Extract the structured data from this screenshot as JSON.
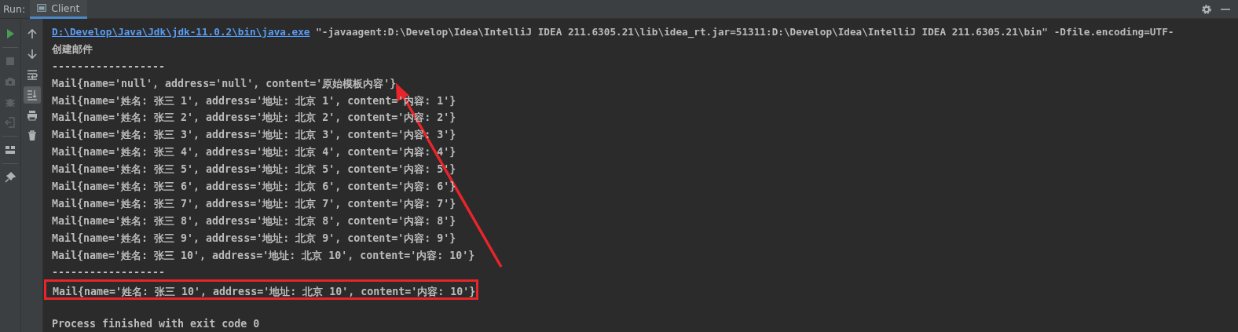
{
  "run_label": "Run:",
  "tabs": [
    {
      "label": "Client",
      "selected": true
    }
  ],
  "run_toolbar": [
    {
      "kind": "run",
      "disabled": false
    },
    {
      "kind": "stop",
      "disabled": true
    },
    {
      "kind": "camera",
      "disabled": true
    },
    {
      "kind": "bug",
      "disabled": true
    },
    {
      "kind": "exit",
      "disabled": true
    },
    {
      "kind": "layout",
      "disabled": false
    },
    {
      "kind": "pin",
      "disabled": false
    }
  ],
  "console_toolbar": [
    {
      "kind": "up",
      "selected": false
    },
    {
      "kind": "down",
      "selected": false
    },
    {
      "kind": "wrap",
      "selected": false
    },
    {
      "kind": "scroll",
      "selected": true
    },
    {
      "kind": "print",
      "selected": false
    },
    {
      "kind": "trash",
      "selected": false
    }
  ],
  "console": [
    {
      "kind": "command",
      "link": "D:\\Develop\\Java\\Jdk\\jdk-11.0.2\\bin\\java.exe",
      "text": " \"-javaagent:D:\\Develop\\Idea\\IntelliJ IDEA 211.6305.21\\lib\\idea_rt.jar=51311:D:\\Develop\\Idea\\IntelliJ IDEA 211.6305.21\\bin\" -Dfile.encoding=UTF-"
    },
    {
      "kind": "text",
      "text": "创建邮件"
    },
    {
      "kind": "text",
      "text": "------------------"
    },
    {
      "kind": "text",
      "text": "Mail{name='null', address='null', content='原始模板内容'}"
    },
    {
      "kind": "text",
      "text": "Mail{name='姓名: 张三 1', address='地址: 北京 1', content='内容: 1'}"
    },
    {
      "kind": "text",
      "text": "Mail{name='姓名: 张三 2', address='地址: 北京 2', content='内容: 2'}"
    },
    {
      "kind": "text",
      "text": "Mail{name='姓名: 张三 3', address='地址: 北京 3', content='内容: 3'}"
    },
    {
      "kind": "text",
      "text": "Mail{name='姓名: 张三 4', address='地址: 北京 4', content='内容: 4'}"
    },
    {
      "kind": "text",
      "text": "Mail{name='姓名: 张三 5', address='地址: 北京 5', content='内容: 5'}"
    },
    {
      "kind": "text",
      "text": "Mail{name='姓名: 张三 6', address='地址: 北京 6', content='内容: 6'}"
    },
    {
      "kind": "text",
      "text": "Mail{name='姓名: 张三 7', address='地址: 北京 7', content='内容: 7'}"
    },
    {
      "kind": "text",
      "text": "Mail{name='姓名: 张三 8', address='地址: 北京 8', content='内容: 8'}"
    },
    {
      "kind": "text",
      "text": "Mail{name='姓名: 张三 9', address='地址: 北京 9', content='内容: 9'}"
    },
    {
      "kind": "text",
      "text": "Mail{name='姓名: 张三 10', address='地址: 北京 10', content='内容: 10'}"
    },
    {
      "kind": "text",
      "text": "------------------"
    },
    {
      "kind": "highlighted",
      "text": "Mail{name='姓名: 张三 10', address='地址: 北京 10', content='内容: 10'}"
    },
    {
      "kind": "blank"
    },
    {
      "kind": "text",
      "text": "Process finished with exit code 0"
    }
  ]
}
